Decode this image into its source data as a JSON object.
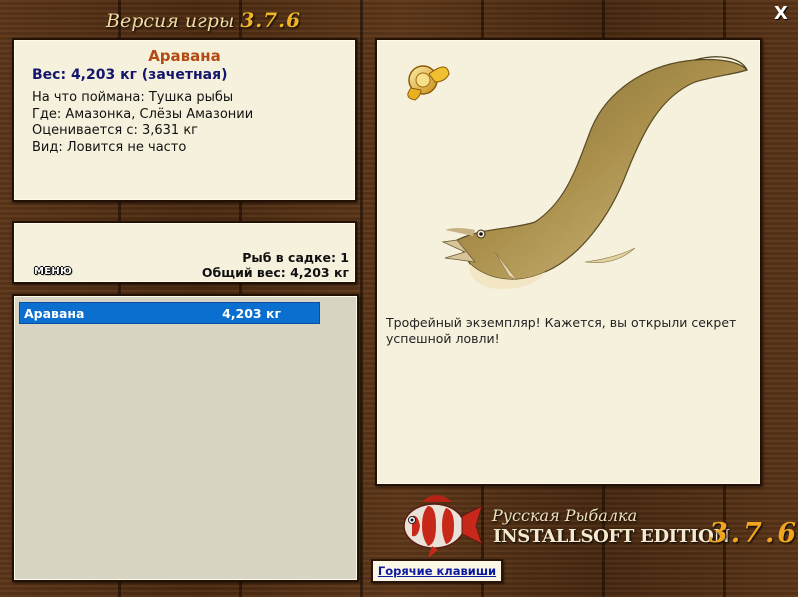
{
  "window": {
    "title_prefix": "Версия игры",
    "title_version": "3.7.6",
    "close_label": "X"
  },
  "info": {
    "fish_name": "Аравана",
    "weight_line": "Вес: 4,203 кг (зачетная)",
    "lines": [
      "На что поймана: Тушка рыбы",
      "Где: Амазонка, Слёзы Амазонии",
      "Оценивается с: 3,631 кг",
      "Вид: Ловится не часто"
    ]
  },
  "summary": {
    "menu_label": "МЕНЮ",
    "fish_count_line": "Рыб в садке: 1",
    "total_weight_line": "Общий вес: 4,203 кг"
  },
  "catch_list": [
    {
      "name": "Аравана",
      "weight": "4,203 кг",
      "selected": true
    }
  ],
  "detail": {
    "description": "Трофейный экземпляр! Кажется, вы открыли секрет успешной ловли!"
  },
  "logo": {
    "line1": "Русская Рыбалка",
    "line2": "INSTALLSOFT EDITION",
    "version": "3.7.6"
  },
  "hotkeys_label": "Горячие клавиши",
  "colors": {
    "selection": "#0a6fcf",
    "fish_name": "#b34a12",
    "weight": "#14166e",
    "link": "#0c1b9e"
  }
}
